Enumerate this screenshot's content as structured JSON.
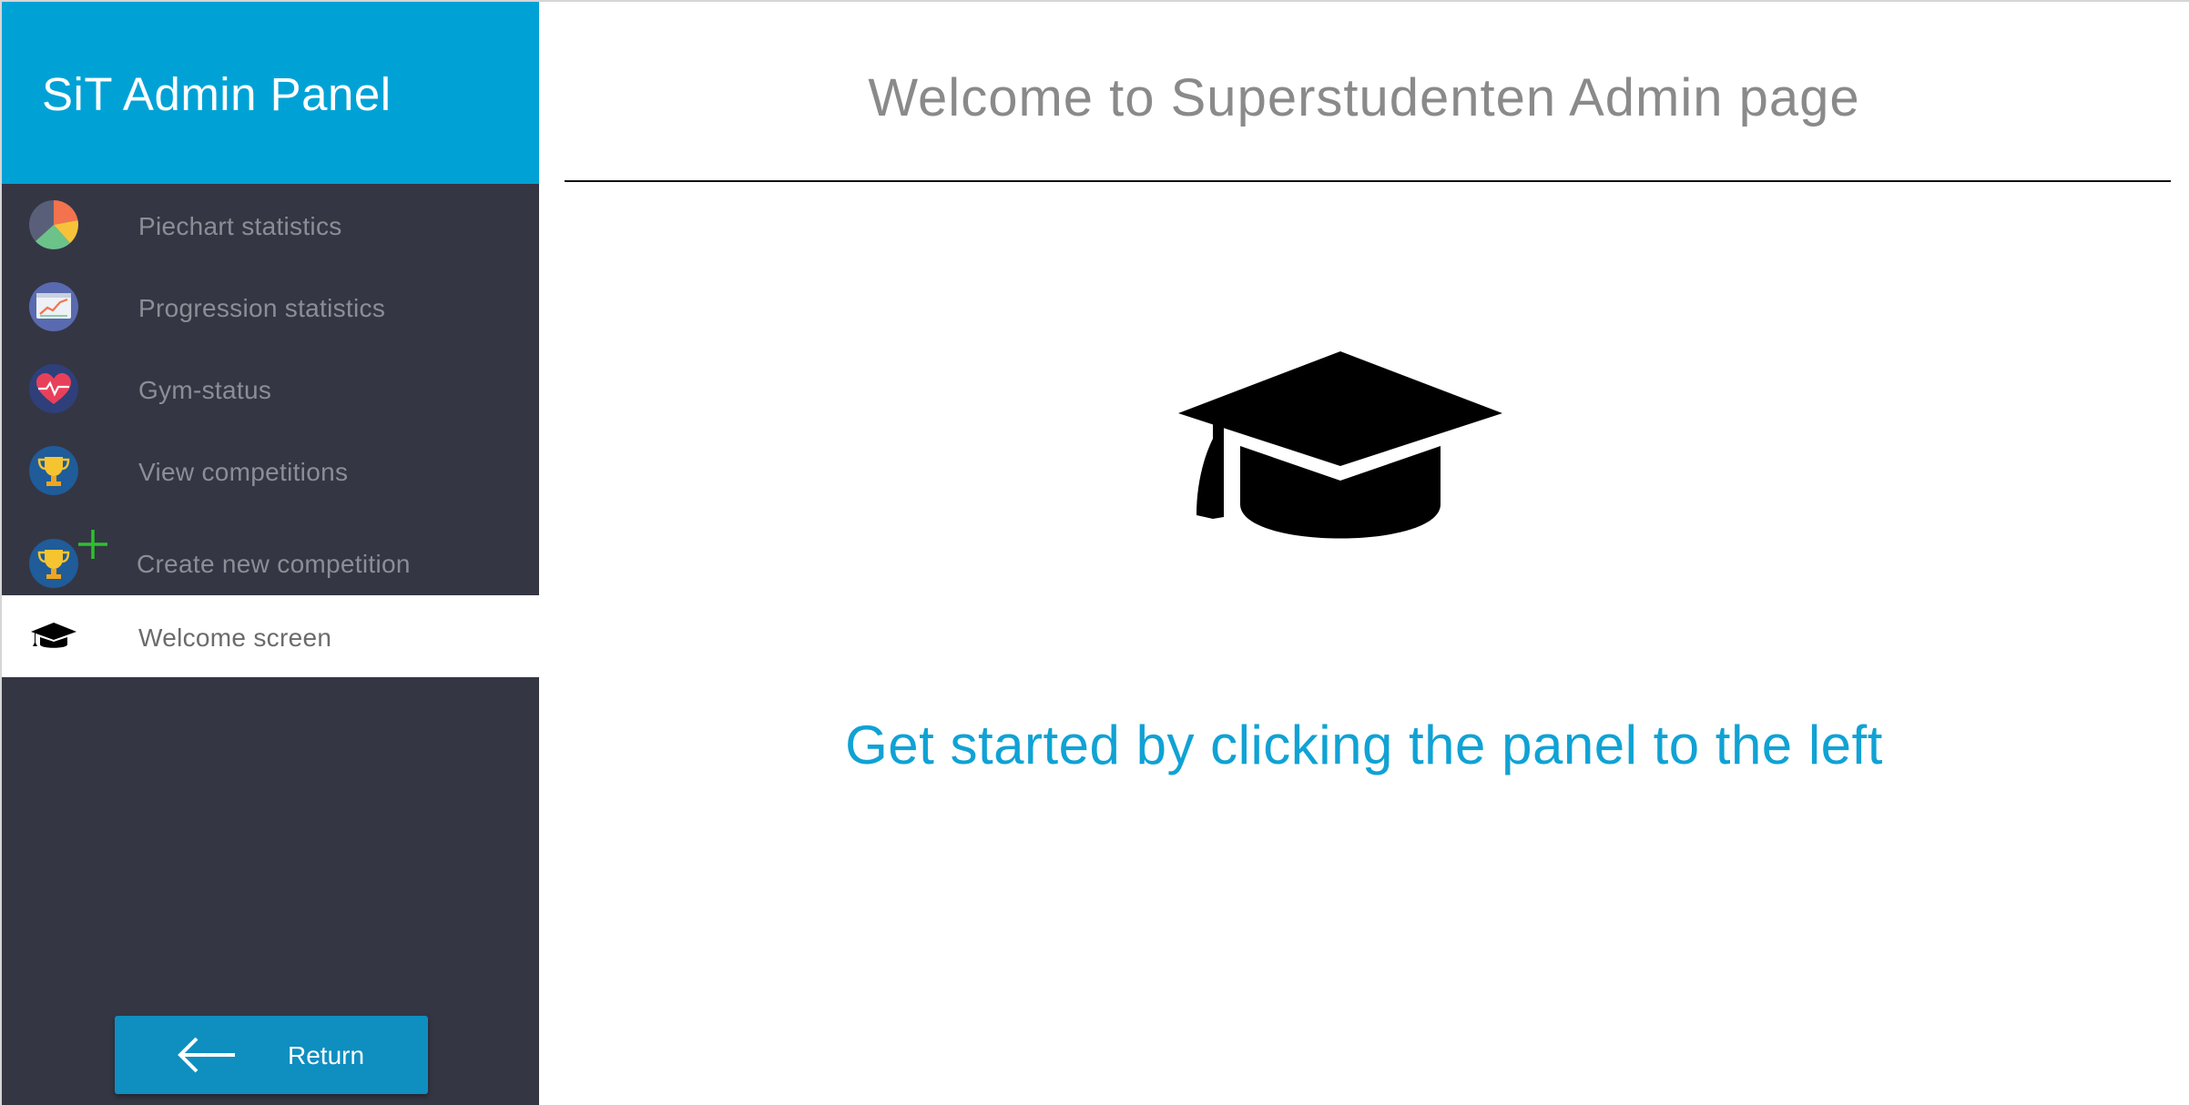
{
  "sidebar": {
    "title": "SiT Admin Panel",
    "items": [
      {
        "label": "Piechart statistics",
        "icon": "piechart-icon"
      },
      {
        "label": "Progression statistics",
        "icon": "line-chart-icon"
      },
      {
        "label": "Gym-status",
        "icon": "heartbeat-icon"
      },
      {
        "label": "View competitions",
        "icon": "trophy-icon"
      },
      {
        "label": "Create new competition",
        "icon": "trophy-plus-icon"
      },
      {
        "label": "Welcome screen",
        "icon": "graduation-cap-icon",
        "active": true
      }
    ],
    "return_label": "Return"
  },
  "main": {
    "title": "Welcome to Superstudenten Admin page",
    "subtitle": "Get started by clicking the panel to the left",
    "icon": "graduation-cap-icon"
  },
  "colors": {
    "header_blue": "#00a2d6",
    "sidebar_bg": "#343644",
    "accent_text": "#10a2d4",
    "button_blue": "#0f8ec0"
  }
}
